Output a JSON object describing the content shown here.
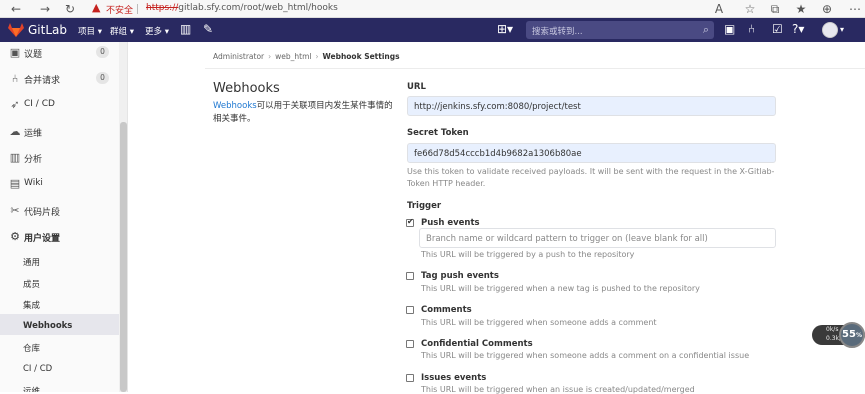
{
  "browser": {
    "insecure_label": "不安全",
    "url_scheme": "https://",
    "url_rest": "gitlab.sfy.com/root/web_html/hooks"
  },
  "header": {
    "app_name": "GitLab",
    "nav": [
      "项目",
      "群组",
      "更多"
    ],
    "search_placeholder": "搜索或转到...",
    "brand_color": "#292961"
  },
  "sidebar": {
    "items": [
      {
        "label": "议题",
        "icon": "issues-icon",
        "badge": "0"
      },
      {
        "label": "合并请求",
        "icon": "merge-request-icon",
        "badge": "0"
      },
      {
        "label": "CI / CD",
        "icon": "rocket-icon"
      },
      {
        "label": "运维",
        "icon": "cloud-icon"
      },
      {
        "label": "分析",
        "icon": "chart-icon"
      },
      {
        "label": "Wiki",
        "icon": "book-icon"
      },
      {
        "label": "代码片段",
        "icon": "scissors-icon"
      },
      {
        "label": "用户设置",
        "icon": "gear-icon"
      }
    ],
    "sub_items": [
      "通用",
      "成员",
      "集成",
      "Webhooks",
      "仓库",
      "CI / CD",
      "运维"
    ],
    "active_sub": "Webhooks"
  },
  "breadcrumb": [
    "Administrator",
    "web_html",
    "Webhook Settings"
  ],
  "page": {
    "title": "Webhooks",
    "desc_link": "Webhooks",
    "desc_text": "可以用于关联项目内发生某件事情的相关事件。",
    "url_label": "URL",
    "url_value": "http://jenkins.sfy.com:8080/project/test",
    "token_label": "Secret Token",
    "token_value": "fe66d78d54cccb1d4b9682a1306b80ae",
    "token_help": "Use this token to validate received payloads. It will be sent with the request in the X-Gitlab-Token HTTP header.",
    "trigger_label": "Trigger",
    "branch_placeholder": "Branch name or wildcard pattern to trigger on (leave blank for all)",
    "triggers": [
      {
        "label": "Push events",
        "checked": true,
        "help": "This URL will be triggered by a push to the repository"
      },
      {
        "label": "Tag push events",
        "checked": false,
        "help": "This URL will be triggered when a new tag is pushed to the repository"
      },
      {
        "label": "Comments",
        "checked": false,
        "help": "This URL will be triggered when someone adds a comment"
      },
      {
        "label": "Confidential Comments",
        "checked": false,
        "help": "This URL will be triggered when someone adds a comment on a confidential issue"
      },
      {
        "label": "Issues events",
        "checked": false,
        "help": "This URL will be triggered when an issue is created/updated/merged"
      }
    ]
  },
  "widget": {
    "up": "0k/s",
    "down": "0.3k/s",
    "percent": "55",
    "percent_unit": "%"
  }
}
